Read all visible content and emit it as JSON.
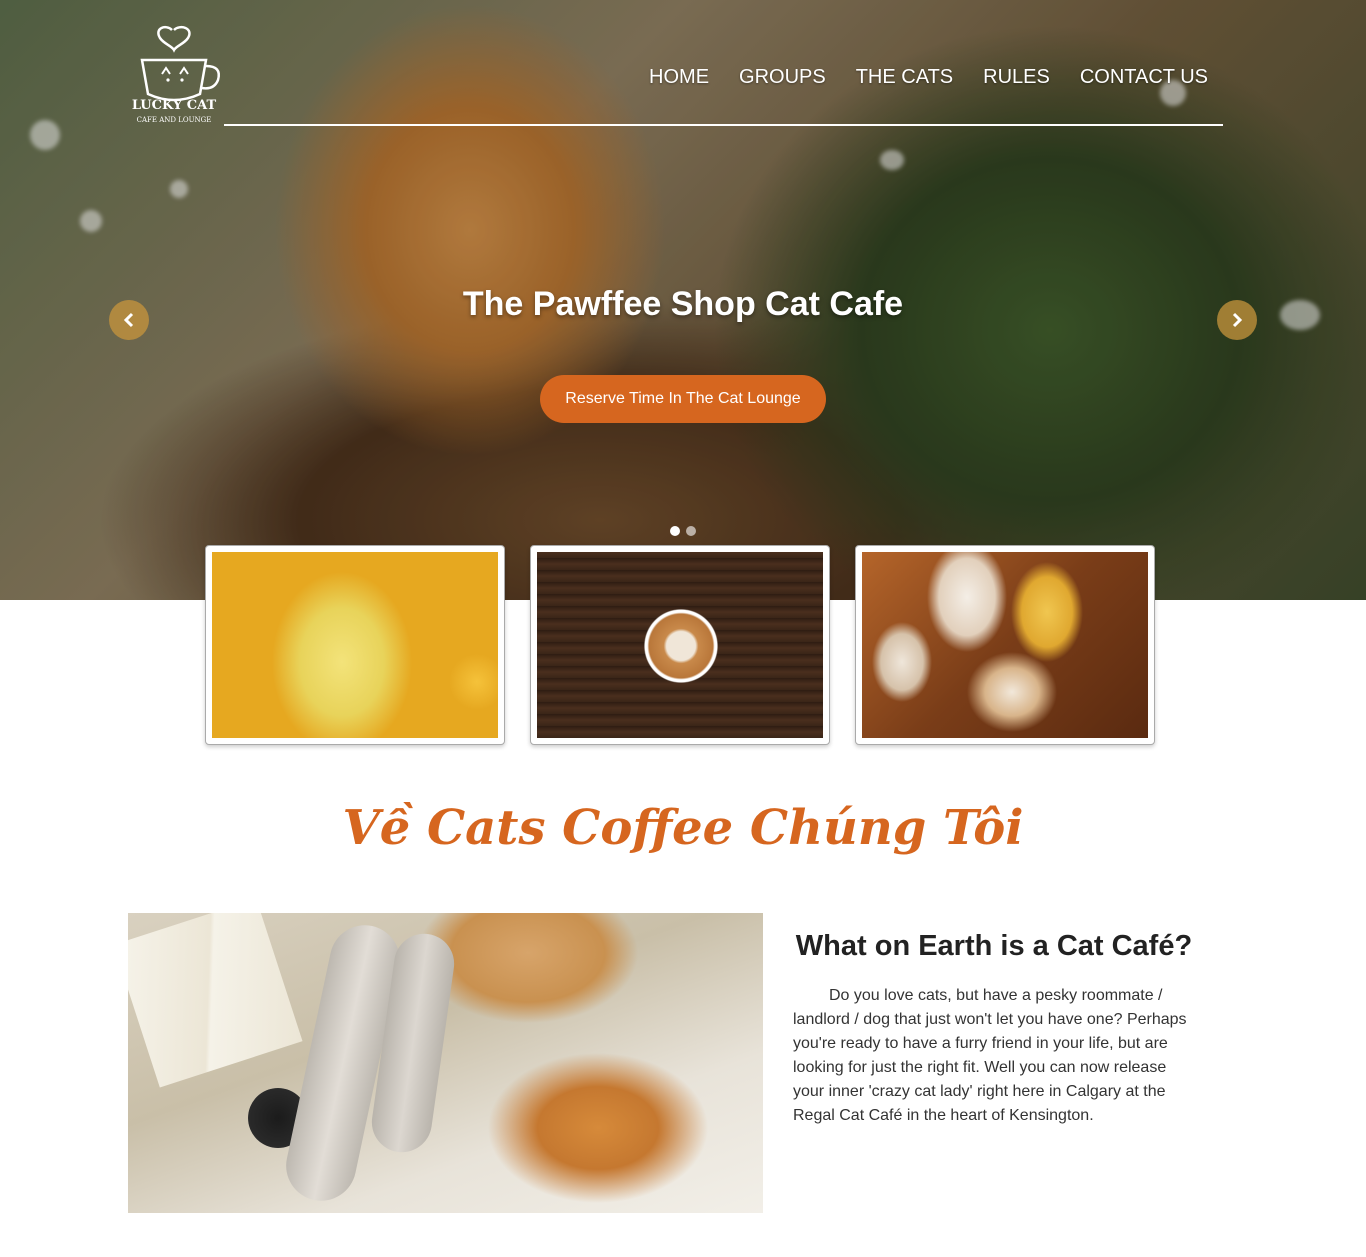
{
  "logo": {
    "brand": "LUCKY CAT",
    "tagline": "CAFE AND LOUNGE"
  },
  "nav": {
    "items": [
      "HOME",
      "GROUPS",
      "THE CATS",
      "RULES",
      "CONTACT US"
    ]
  },
  "hero": {
    "title": "The Pawffee Shop Cat Cafe",
    "cta_label": "Reserve Time In The Cat Lounge",
    "slide_count": 2,
    "active_slide": 1
  },
  "thumbnails": [
    "lemonade",
    "latte-art",
    "iced-coffees"
  ],
  "about": {
    "section_title": "Về Cats Coffee Chúng Tôi",
    "heading": "What on Earth is a Cat Café?",
    "body": "Do you love cats, but have a pesky roommate / landlord / dog that just won't let you have one? Perhaps you're ready to have a furry friend in your life, but are looking for just the right fit. Well you can now release your inner 'crazy cat lady' right here in Calgary at the Regal Cat Café in the heart of Kensington."
  },
  "colors": {
    "accent": "#d6661f",
    "arrow": "#c8963c",
    "text": "#333333"
  }
}
